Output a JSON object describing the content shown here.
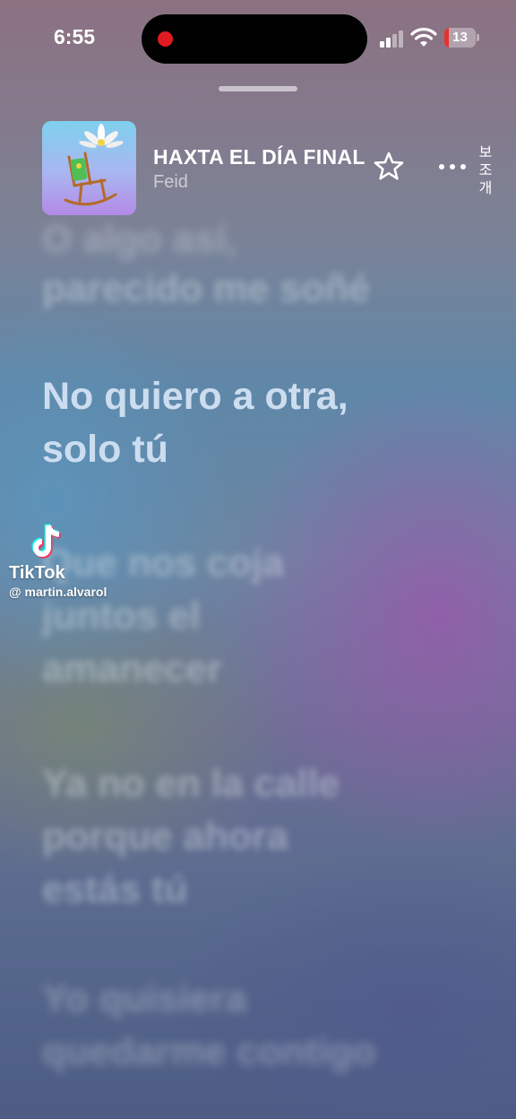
{
  "status_bar": {
    "time": "6:55",
    "battery_level": "13",
    "recording": true,
    "signal_bars_active": 2,
    "colors": {
      "recording_dot": "#e11b22",
      "battery_low": "#e5322d"
    }
  },
  "now_playing": {
    "title": "HAXTA EL DÍA FINAL",
    "artist": "Feid",
    "artwork_icon": "album-art-rocking-chair-flower",
    "favorite_icon": "star-outline-icon",
    "more_icon": "ellipsis-icon"
  },
  "side_label": [
    "보",
    "조",
    "개"
  ],
  "lyrics": {
    "partial_top": "O algo así,",
    "previous": "parecido me soñé",
    "current_line_1": "No quiero a otra,",
    "current_line_2": "solo tú",
    "next_1_line_1": "Que nos coja",
    "next_1_line_2": "juntos el",
    "next_1_line_3": "amanecer",
    "next_2_line_1": "Ya no en la calle",
    "next_2_line_2": "porque ahora",
    "next_2_line_3": "estás tú",
    "next_3_line_1": "Yo quisiera",
    "next_3_line_2": "quedarme contigo"
  },
  "watermark": {
    "brand": "TikTok",
    "handle": "@ martin.alvarol"
  }
}
